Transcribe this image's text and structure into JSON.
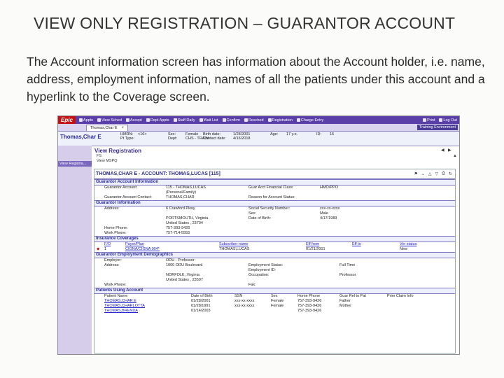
{
  "slide": {
    "title": "VIEW ONLY REGISTRATION – GUARANTOR ACCOUNT",
    "body": "The Account information screen has information about the Account holder, i.e. name, address, employment information, names of all the patients under this account and a hyperlink to the Coverage screen."
  },
  "toolbar": {
    "logo": "Epic",
    "buttons": [
      "Appts",
      "View Sched",
      "Accept",
      "Dept Appts",
      "Staff Daily",
      "Wait List",
      "Confirm",
      "Resched",
      "Registration",
      "Charge Entry"
    ],
    "right_buttons": [
      "Print",
      "Log Out"
    ]
  },
  "tab": {
    "label": "Thomas,Char E",
    "close": "×",
    "environment": "Training Environment"
  },
  "patient_header": {
    "name": "Thomas,Char E",
    "hmrn_label": "HMRN:",
    "hmrn_value": "<16>",
    "pt_type_label": "Pt Type:",
    "sex_label": "Sex:",
    "sex_value": "Female",
    "dept_label": "Dept:",
    "dept_value": "CHS - TRAIN",
    "birth_label": "Birth date:",
    "birth_value": "1/28/2001",
    "contact_label": "Contact date:",
    "contact_value": "4/16/2018",
    "age_label": "Age:",
    "age_value": "17 y.o.",
    "id_label": "ID:",
    "id_value": "16"
  },
  "sidebar": {
    "item": "View Registra..."
  },
  "activity": {
    "title": "View Registration",
    "sub1": "FS",
    "sub2": "View MSPQ"
  },
  "report": {
    "title": "THOMAS,CHAR E - ACCOUNT: THOMAS,LUCAS [115]",
    "sections": {
      "guarantor_account": "Guarantor Account Information",
      "guarantor_info": "Guarantor Information",
      "coverages": "Insurance Coverages",
      "employment": "Guarantor Employment Demographics",
      "patients": "Patients Using Account"
    },
    "ga": {
      "account_label": "Guarantor Account:",
      "account_value": "115 - THOMAS,LUCAS",
      "account_value2": "(Personal/Family)",
      "fin_class_label": "Guar Acct Financial Class:",
      "fin_class_value": "HMO/PPO",
      "contact_label": "Guarantor Account Contact:",
      "contact_value": "THOMAS,CHAR",
      "status_label": "Reason for Account Status:"
    },
    "gi": {
      "address_label": "Address:",
      "address_line1": "6 Crawford Pkwy",
      "address_line2": "PORTSMOUTH, Virginia",
      "address_line3": "United States , 23704",
      "ssn_label": "Social Security Number:",
      "ssn_value": "xxx-xx-xxxx",
      "sex_label": "Sex:",
      "sex_value": "Male",
      "dob_label": "Date of Birth:",
      "dob_value": "4/17/1983",
      "home_label": "Home Phone:",
      "home_value": "757-393-9426",
      "work_label": "Work Phone:",
      "work_value": "757-714-5555"
    },
    "cov": {
      "headers": [
        "F/O",
        "Payor/Plan",
        "Subscriber name",
        "Eff from",
        "Eff to",
        "Ver status"
      ],
      "row": [
        "1",
        "CIGNA/CIGNA 004*",
        "THOMAS,LUCAS",
        "01/21/2001",
        "",
        "New"
      ]
    },
    "emp": {
      "employer_label": "Employer:",
      "employer_value": "ODU - Professor",
      "address_label": "Address:",
      "address_line1": "1000 ODU Boulevard",
      "address_line2": "NORFOLK, Virginia",
      "address_line3": "United States , 23507",
      "status_label": "Employment Status:",
      "status_value": "Full Time",
      "id_label": "Employment ID:",
      "occ_label": "Occupation:",
      "occ_value": "Professor",
      "work_label": "Work Phone:",
      "fax_label": "Fax:"
    },
    "pts": {
      "headers": [
        "Patient Name",
        "Date of Birth",
        "SSN",
        "Sex",
        "Home Phone",
        "Guar Rel to Pat",
        "Prim Claim Info"
      ],
      "rows": [
        [
          "THOMAS,CHAR E",
          "01/28/2001",
          "xxx-xx-xxxx",
          "Female",
          "757-393-9426",
          "Father",
          ""
        ],
        [
          "THOMAS,CHARLOTTA",
          "01/28/1991",
          "xxx-xx-xxxx",
          "Female",
          "757-393-9426",
          "Mother",
          ""
        ],
        [
          "THOMAS,BRENDA",
          "01/14/2003",
          "",
          "",
          "757-393-9426",
          "",
          ""
        ]
      ]
    }
  },
  "colors": {
    "toolbar": "#5a3fa8",
    "epic_logo": "#c41212",
    "section_text": "#2b2b9e",
    "link": "#2424d0"
  }
}
